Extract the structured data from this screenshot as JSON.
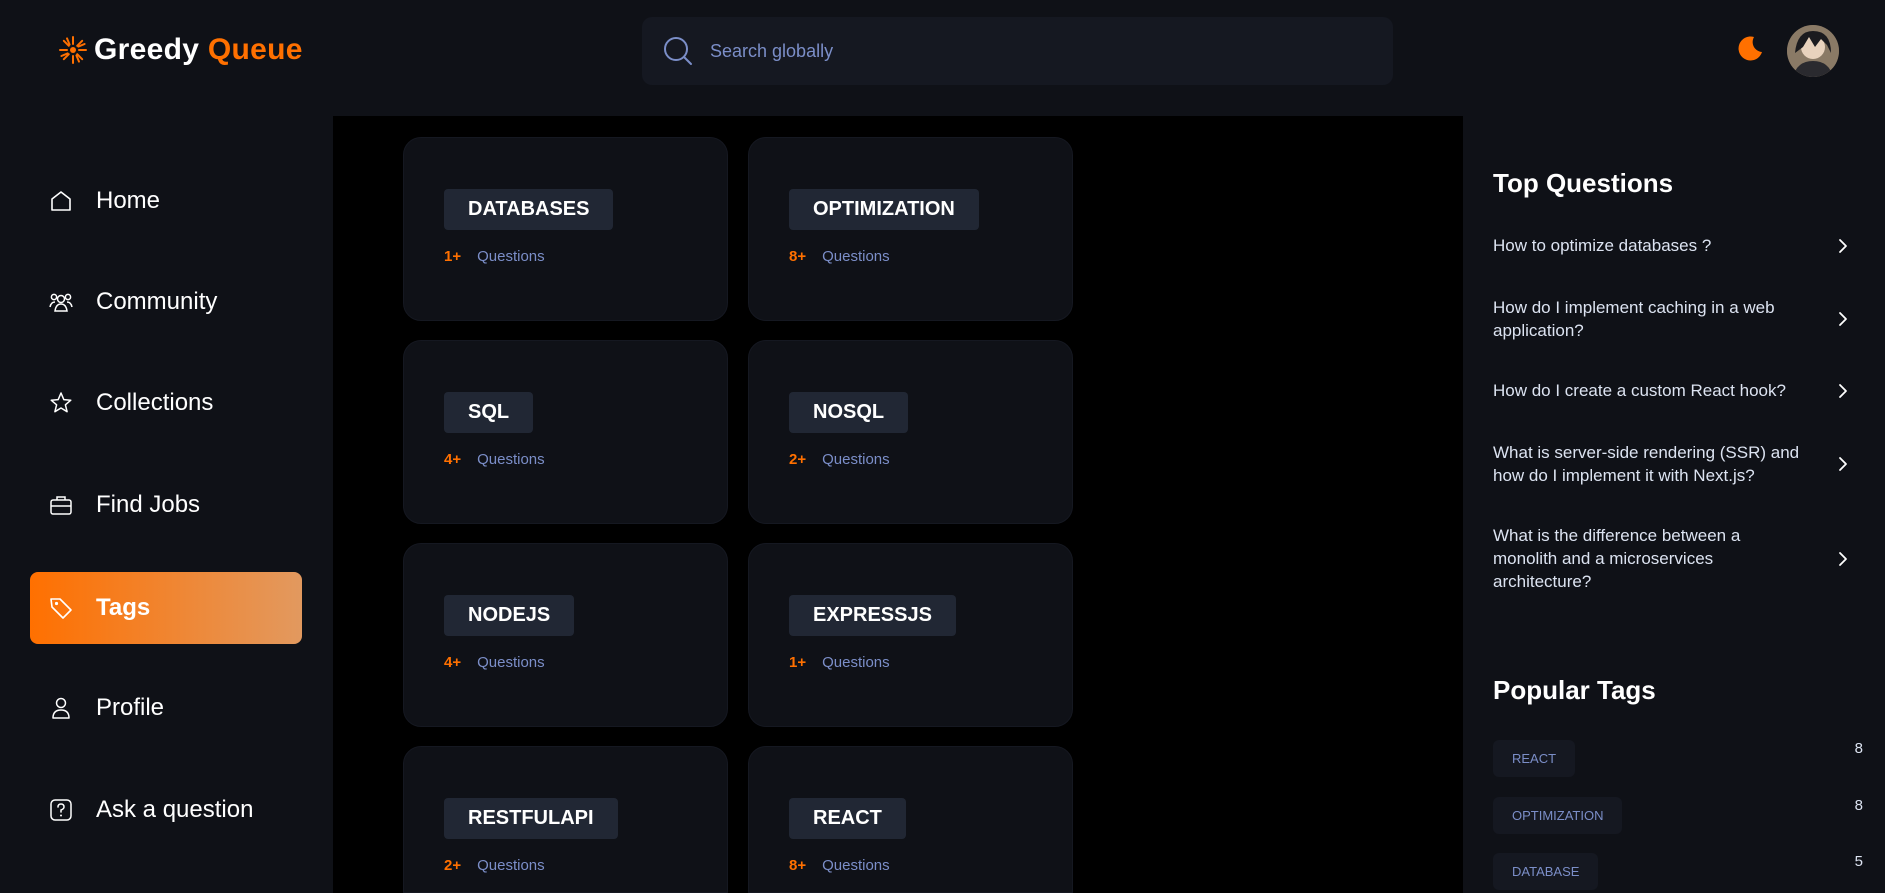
{
  "brand": {
    "name_part1": "Greedy",
    "name_part2": "Queue",
    "accent": "#ff7000"
  },
  "search": {
    "placeholder": "Search globally"
  },
  "header": {
    "theme_icon": "moon-icon",
    "avatar": "user-avatar"
  },
  "sidebar": {
    "items": [
      {
        "label": "Home",
        "icon": "home-icon"
      },
      {
        "label": "Community",
        "icon": "users-icon"
      },
      {
        "label": "Collections",
        "icon": "star-icon"
      },
      {
        "label": "Find Jobs",
        "icon": "suitcase-icon"
      },
      {
        "label": "Tags",
        "icon": "tag-icon",
        "active": true
      },
      {
        "label": "Profile",
        "icon": "user-icon"
      },
      {
        "label": "Ask a question",
        "icon": "question-icon"
      }
    ]
  },
  "tags": [
    {
      "name": "DATABASES",
      "count": "1+",
      "suffix": "Questions"
    },
    {
      "name": "OPTIMIZATION",
      "count": "8+",
      "suffix": "Questions"
    },
    {
      "name": "SQL",
      "count": "4+",
      "suffix": "Questions"
    },
    {
      "name": "NOSQL",
      "count": "2+",
      "suffix": "Questions"
    },
    {
      "name": "NODEJS",
      "count": "4+",
      "suffix": "Questions"
    },
    {
      "name": "EXPRESSJS",
      "count": "1+",
      "suffix": "Questions"
    },
    {
      "name": "RESTFULAPI",
      "count": "2+",
      "suffix": "Questions"
    },
    {
      "name": "REACT",
      "count": "8+",
      "suffix": "Questions"
    }
  ],
  "right_sidebar": {
    "top_questions_title": "Top Questions",
    "top_questions": [
      "How to optimize databases ?",
      "How do I implement caching in a web application?",
      "How do I create a custom React hook?",
      "What is server-side rendering (SSR) and how do I implement it with Next.js?",
      "What is the difference between a monolith and a microservices architecture?"
    ],
    "popular_tags_title": "Popular Tags",
    "popular_tags": [
      {
        "name": "REACT",
        "count": "8"
      },
      {
        "name": "OPTIMIZATION",
        "count": "8"
      },
      {
        "name": "DATABASE",
        "count": "5"
      }
    ]
  },
  "colors": {
    "background": "#000000",
    "panel": "#0f1117",
    "pill": "#212734",
    "muted_blue": "#7b8ec8",
    "accent": "#ff7000"
  }
}
